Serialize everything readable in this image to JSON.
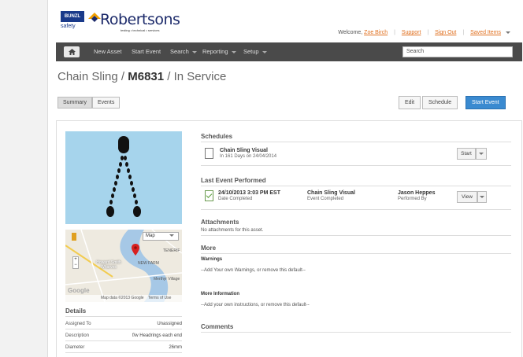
{
  "brand": {
    "bunzl": "BUNZL",
    "safety": "safety",
    "robertsons": "Robertsons",
    "tagline": "testing • technical • services"
  },
  "topbar": {
    "welcome": "Welcome,",
    "user": "Zoe Birch",
    "support": "Support",
    "signout": "Sign Out",
    "saved": "Saved Items"
  },
  "nav": {
    "home_icon": "home-icon",
    "items": [
      "New Asset",
      "Start Event",
      "Search",
      "Reporting",
      "Setup"
    ],
    "search_placeholder": "Search"
  },
  "title": {
    "type": "Chain Sling /",
    "id": "M6831",
    "status": "/ In Service"
  },
  "tabs": [
    "Summary",
    "Events"
  ],
  "actions": {
    "edit": "Edit",
    "schedule": "Schedule",
    "start_event": "Start Event"
  },
  "map": {
    "type_select": "Map",
    "labels": [
      "Howard Smith Wharves",
      "NEW FARM",
      "Merthyr Village",
      "TENERIF"
    ],
    "footer_data": "Map data ©2013 Google",
    "footer_terms": "Terms of Use",
    "google": "Google"
  },
  "details": {
    "title": "Details",
    "rows": [
      {
        "label": "Assigned To",
        "value": "Unassigned"
      },
      {
        "label": "Description",
        "value": "f/w Headrings each end"
      },
      {
        "label": "Diameter",
        "value": "26mm"
      }
    ]
  },
  "schedules": {
    "title": "Schedules",
    "item_name": "Chain Sling Visual",
    "item_due": "In 161 Days on 24/04/2014",
    "start": "Start"
  },
  "last_event": {
    "title": "Last Event Performed",
    "date": "24/10/2013 3:03 PM EST",
    "date_label": "Date Completed",
    "event": "Chain Sling Visual",
    "event_label": "Event Completed",
    "person": "Jason Heppes",
    "person_label": "Performed By",
    "view": "View"
  },
  "attachments": {
    "title": "Attachments",
    "empty": "No attachments for this asset."
  },
  "more": {
    "title": "More",
    "warnings_title": "Warnings",
    "warnings_text": "--Add Your own Warnings, or remove this default--",
    "info_title": "More Information",
    "info_text": "--Add your own instructions, or remove this default--"
  },
  "comments": {
    "title": "Comments"
  },
  "colors": {
    "accent": "#3a8ad0",
    "link": "#e07020",
    "navbar": "#4a4a4a"
  }
}
